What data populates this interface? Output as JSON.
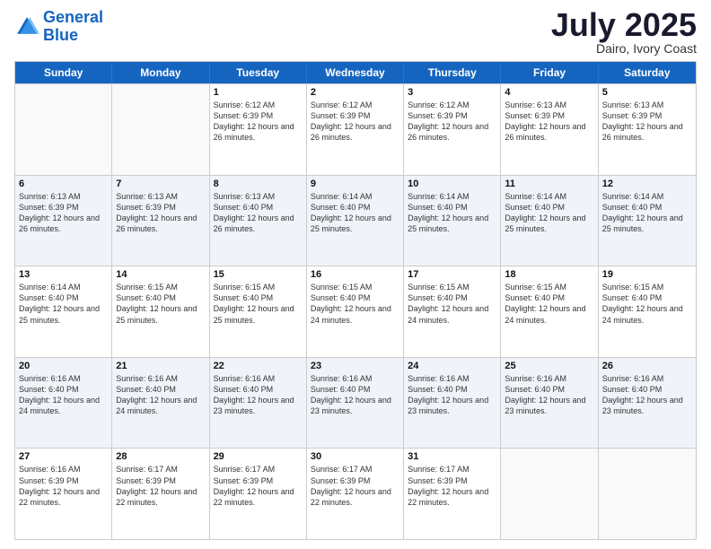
{
  "logo": {
    "line1": "General",
    "line2": "Blue"
  },
  "title": "July 2025",
  "subtitle": "Dairo, Ivory Coast",
  "headers": [
    "Sunday",
    "Monday",
    "Tuesday",
    "Wednesday",
    "Thursday",
    "Friday",
    "Saturday"
  ],
  "weeks": [
    [
      {
        "day": "",
        "info": ""
      },
      {
        "day": "",
        "info": ""
      },
      {
        "day": "1",
        "info": "Sunrise: 6:12 AM\nSunset: 6:39 PM\nDaylight: 12 hours and 26 minutes."
      },
      {
        "day": "2",
        "info": "Sunrise: 6:12 AM\nSunset: 6:39 PM\nDaylight: 12 hours and 26 minutes."
      },
      {
        "day": "3",
        "info": "Sunrise: 6:12 AM\nSunset: 6:39 PM\nDaylight: 12 hours and 26 minutes."
      },
      {
        "day": "4",
        "info": "Sunrise: 6:13 AM\nSunset: 6:39 PM\nDaylight: 12 hours and 26 minutes."
      },
      {
        "day": "5",
        "info": "Sunrise: 6:13 AM\nSunset: 6:39 PM\nDaylight: 12 hours and 26 minutes."
      }
    ],
    [
      {
        "day": "6",
        "info": "Sunrise: 6:13 AM\nSunset: 6:39 PM\nDaylight: 12 hours and 26 minutes."
      },
      {
        "day": "7",
        "info": "Sunrise: 6:13 AM\nSunset: 6:39 PM\nDaylight: 12 hours and 26 minutes."
      },
      {
        "day": "8",
        "info": "Sunrise: 6:13 AM\nSunset: 6:40 PM\nDaylight: 12 hours and 26 minutes."
      },
      {
        "day": "9",
        "info": "Sunrise: 6:14 AM\nSunset: 6:40 PM\nDaylight: 12 hours and 25 minutes."
      },
      {
        "day": "10",
        "info": "Sunrise: 6:14 AM\nSunset: 6:40 PM\nDaylight: 12 hours and 25 minutes."
      },
      {
        "day": "11",
        "info": "Sunrise: 6:14 AM\nSunset: 6:40 PM\nDaylight: 12 hours and 25 minutes."
      },
      {
        "day": "12",
        "info": "Sunrise: 6:14 AM\nSunset: 6:40 PM\nDaylight: 12 hours and 25 minutes."
      }
    ],
    [
      {
        "day": "13",
        "info": "Sunrise: 6:14 AM\nSunset: 6:40 PM\nDaylight: 12 hours and 25 minutes."
      },
      {
        "day": "14",
        "info": "Sunrise: 6:15 AM\nSunset: 6:40 PM\nDaylight: 12 hours and 25 minutes."
      },
      {
        "day": "15",
        "info": "Sunrise: 6:15 AM\nSunset: 6:40 PM\nDaylight: 12 hours and 25 minutes."
      },
      {
        "day": "16",
        "info": "Sunrise: 6:15 AM\nSunset: 6:40 PM\nDaylight: 12 hours and 24 minutes."
      },
      {
        "day": "17",
        "info": "Sunrise: 6:15 AM\nSunset: 6:40 PM\nDaylight: 12 hours and 24 minutes."
      },
      {
        "day": "18",
        "info": "Sunrise: 6:15 AM\nSunset: 6:40 PM\nDaylight: 12 hours and 24 minutes."
      },
      {
        "day": "19",
        "info": "Sunrise: 6:15 AM\nSunset: 6:40 PM\nDaylight: 12 hours and 24 minutes."
      }
    ],
    [
      {
        "day": "20",
        "info": "Sunrise: 6:16 AM\nSunset: 6:40 PM\nDaylight: 12 hours and 24 minutes."
      },
      {
        "day": "21",
        "info": "Sunrise: 6:16 AM\nSunset: 6:40 PM\nDaylight: 12 hours and 24 minutes."
      },
      {
        "day": "22",
        "info": "Sunrise: 6:16 AM\nSunset: 6:40 PM\nDaylight: 12 hours and 23 minutes."
      },
      {
        "day": "23",
        "info": "Sunrise: 6:16 AM\nSunset: 6:40 PM\nDaylight: 12 hours and 23 minutes."
      },
      {
        "day": "24",
        "info": "Sunrise: 6:16 AM\nSunset: 6:40 PM\nDaylight: 12 hours and 23 minutes."
      },
      {
        "day": "25",
        "info": "Sunrise: 6:16 AM\nSunset: 6:40 PM\nDaylight: 12 hours and 23 minutes."
      },
      {
        "day": "26",
        "info": "Sunrise: 6:16 AM\nSunset: 6:40 PM\nDaylight: 12 hours and 23 minutes."
      }
    ],
    [
      {
        "day": "27",
        "info": "Sunrise: 6:16 AM\nSunset: 6:39 PM\nDaylight: 12 hours and 22 minutes."
      },
      {
        "day": "28",
        "info": "Sunrise: 6:17 AM\nSunset: 6:39 PM\nDaylight: 12 hours and 22 minutes."
      },
      {
        "day": "29",
        "info": "Sunrise: 6:17 AM\nSunset: 6:39 PM\nDaylight: 12 hours and 22 minutes."
      },
      {
        "day": "30",
        "info": "Sunrise: 6:17 AM\nSunset: 6:39 PM\nDaylight: 12 hours and 22 minutes."
      },
      {
        "day": "31",
        "info": "Sunrise: 6:17 AM\nSunset: 6:39 PM\nDaylight: 12 hours and 22 minutes."
      },
      {
        "day": "",
        "info": ""
      },
      {
        "day": "",
        "info": ""
      }
    ]
  ]
}
